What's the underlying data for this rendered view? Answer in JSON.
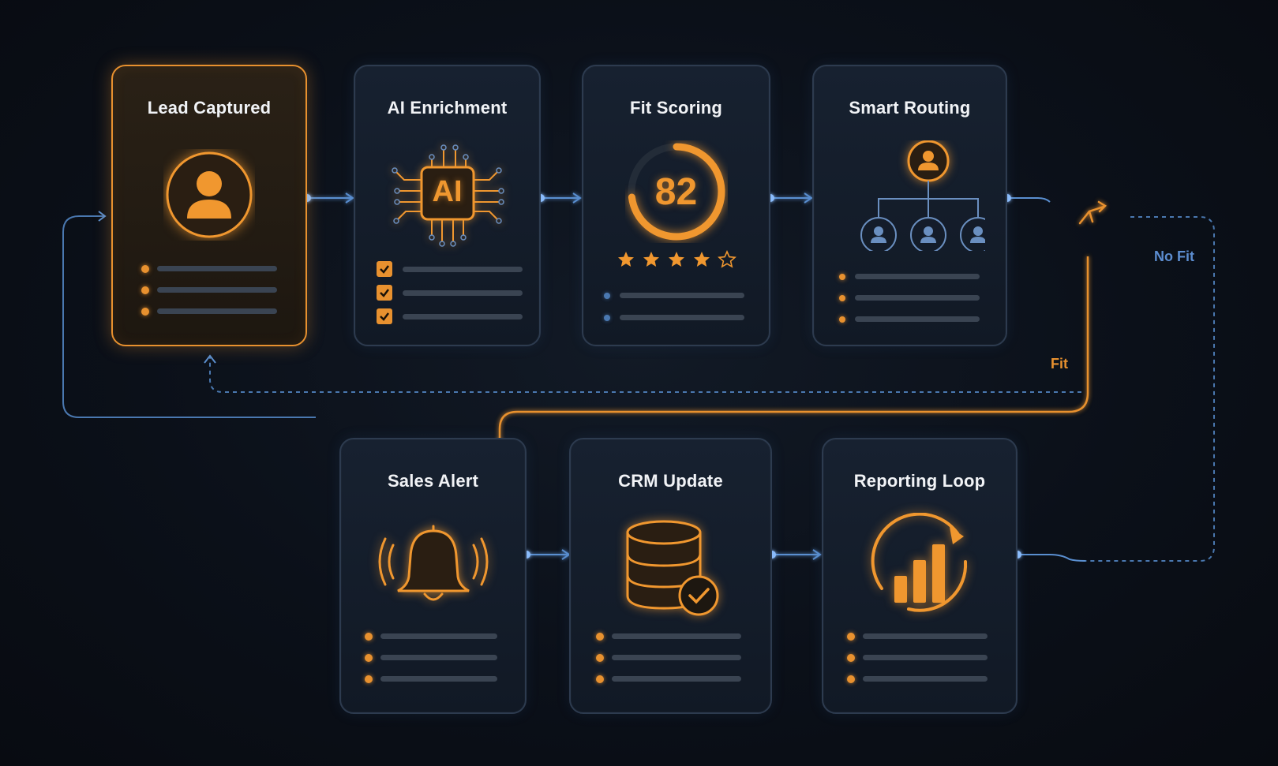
{
  "colors": {
    "accent": "#e8912f",
    "connector": "#4a78b0",
    "background": "#0b0f16",
    "card_border": "#2d3b4f"
  },
  "cards": {
    "lead_captured": {
      "title": "Lead Captured",
      "icon": "user-icon"
    },
    "ai_enrichment": {
      "title": "AI Enrichment",
      "icon": "ai-chip-icon",
      "chip_text": "AI"
    },
    "fit_scoring": {
      "title": "Fit Scoring",
      "icon": "score-gauge-icon",
      "score": "82",
      "stars_filled": 4,
      "stars_total": 5
    },
    "smart_routing": {
      "title": "Smart Routing",
      "icon": "routing-tree-icon"
    },
    "sales_alert": {
      "title": "Sales Alert",
      "icon": "bell-icon"
    },
    "crm_update": {
      "title": "CRM Update",
      "icon": "database-check-icon"
    },
    "reporting_loop": {
      "title": "Reporting Loop",
      "icon": "chart-loop-icon"
    }
  },
  "decision": {
    "icon": "decision-diamond-icon",
    "fit_label": "Fit",
    "no_fit_label": "No Fit"
  }
}
